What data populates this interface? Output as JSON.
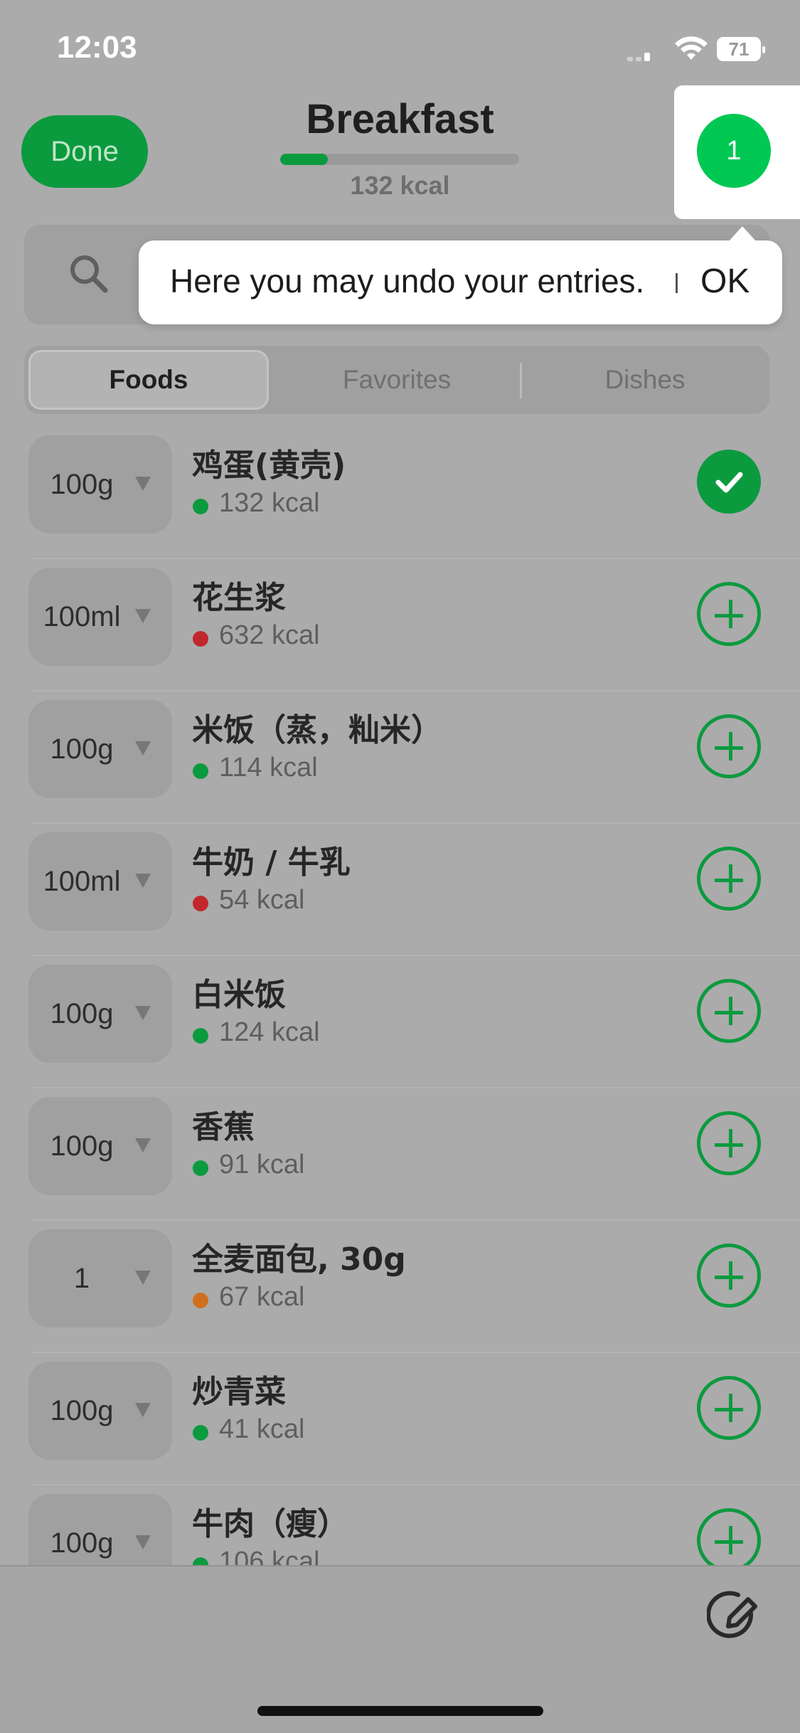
{
  "status_bar": {
    "time": "12:03",
    "battery": "71"
  },
  "header": {
    "done_label": "Done",
    "meal_title": "Breakfast",
    "meal_kcal": "132 kcal",
    "progress_fraction": 0.2,
    "undo_count": "1"
  },
  "tooltip": {
    "text": "Here you may undo your entries.",
    "ok_label": "OK"
  },
  "tabs": [
    {
      "label": "Foods",
      "active": true
    },
    {
      "label": "Favorites",
      "active": false
    },
    {
      "label": "Dishes",
      "active": false
    }
  ],
  "foods": [
    {
      "portion": "100g",
      "name": "鸡蛋(黄壳)",
      "kcal": "132 kcal",
      "dot_color": "#0c9a3f",
      "added": true
    },
    {
      "portion": "100ml",
      "name": "花生浆",
      "kcal": "632 kcal",
      "dot_color": "#c0282d",
      "added": false
    },
    {
      "portion": "100g",
      "name": "米饭（蒸，籼米）",
      "kcal": "114 kcal",
      "dot_color": "#0c9a3f",
      "added": false
    },
    {
      "portion": "100ml",
      "name": "牛奶 / 牛乳",
      "kcal": "54 kcal",
      "dot_color": "#c0282d",
      "added": false
    },
    {
      "portion": "100g",
      "name": "白米饭",
      "kcal": "124 kcal",
      "dot_color": "#0c9a3f",
      "added": false
    },
    {
      "portion": "100g",
      "name": "香蕉",
      "kcal": "91 kcal",
      "dot_color": "#0c9a3f",
      "added": false
    },
    {
      "portion": "1",
      "name": "全麦面包, 30g",
      "kcal": "67 kcal",
      "dot_color": "#d0701e",
      "added": false
    },
    {
      "portion": "100g",
      "name": "炒青菜",
      "kcal": "41 kcal",
      "dot_color": "#0c9a3f",
      "added": false
    },
    {
      "portion": "100g",
      "name": "牛肉（瘦）",
      "kcal": "106 kcal",
      "dot_color": "#0c9a3f",
      "added": false
    }
  ],
  "colors": {
    "accent_green": "#0c9a3f",
    "bright_green": "#00c853"
  },
  "icons": {
    "search": "search-icon",
    "edit": "edit-icon",
    "add": "plus-circle-icon",
    "added": "check-circle-icon"
  }
}
